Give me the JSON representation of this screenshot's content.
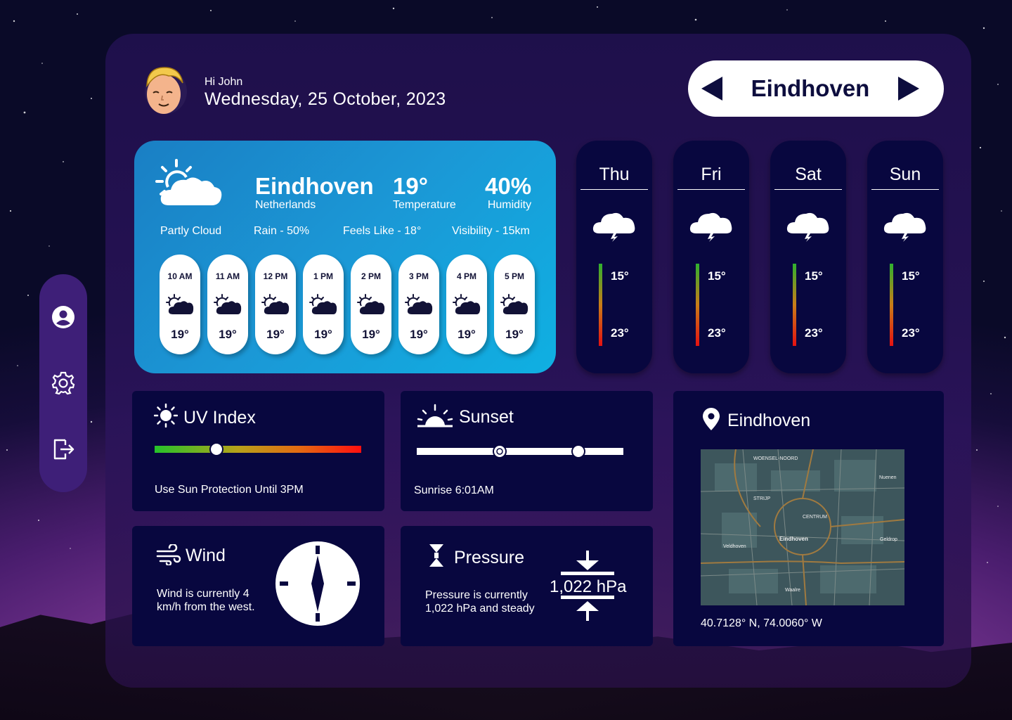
{
  "user": {
    "greeting": "Hi John",
    "date": "Wednesday, 25 October, 2023"
  },
  "city_switch": {
    "city": "Eindhoven"
  },
  "today": {
    "city": "Eindhoven",
    "country": "Netherlands",
    "temperature": "19°",
    "temperature_label": "Temperature",
    "humidity": "40%",
    "humidity_label": "Humidity",
    "condition": "Partly Cloud",
    "rain": "Rain - 50%",
    "feels_like": "Feels Like - 18°",
    "visibility": "Visibility - 15km",
    "hours": [
      {
        "time": "10 AM",
        "temp": "19°"
      },
      {
        "time": "11 AM",
        "temp": "19°"
      },
      {
        "time": "12 PM",
        "temp": "19°"
      },
      {
        "time": "1 PM",
        "temp": "19°"
      },
      {
        "time": "2 PM",
        "temp": "19°"
      },
      {
        "time": "3 PM",
        "temp": "19°"
      },
      {
        "time": "4 PM",
        "temp": "19°"
      },
      {
        "time": "5 PM",
        "temp": "19°"
      }
    ]
  },
  "forecast": [
    {
      "day": "Thu",
      "high": "15°",
      "low": "23°"
    },
    {
      "day": "Fri",
      "high": "15°",
      "low": "23°"
    },
    {
      "day": "Sat",
      "high": "15°",
      "low": "23°"
    },
    {
      "day": "Sun",
      "high": "15°",
      "low": "23°"
    }
  ],
  "uv": {
    "title": "UV Index",
    "note": "Use Sun Protection Until 3PM",
    "level_fraction": 0.3
  },
  "sunset": {
    "title": "Sunset",
    "sunrise": "Sunrise 6:01AM"
  },
  "wind": {
    "title": "Wind",
    "description": "Wind is currently 4 km/h from the west."
  },
  "pressure": {
    "title": "Pressure",
    "description": "Pressure is currently 1,022 hPa and steady",
    "value": "1,022 hPa"
  },
  "map": {
    "title": "Eindhoven",
    "coords": "40.7128° N, 74.0060° W",
    "labels": {
      "north": "WOENSEL-NOORD",
      "center": "CENTRUM",
      "city": "Eindhoven",
      "west": "Veldhoven",
      "south": "Waalre",
      "strijp": "STRIJP",
      "east1": "Nuenen",
      "east2": "Geldrop"
    }
  },
  "colors": {
    "today_start": "#1a7fc4",
    "today_end": "#0fb0e2",
    "card": "#08073f",
    "sidebar": "#3e1f78"
  }
}
